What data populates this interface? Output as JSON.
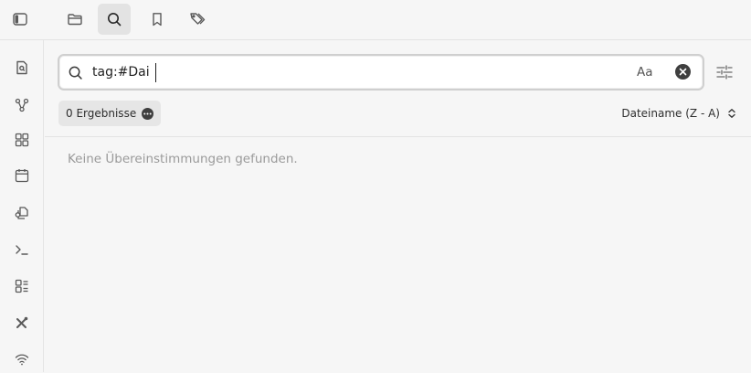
{
  "topbar": {
    "tabs": [
      {
        "icon": "folder-icon",
        "label": "Dateien"
      },
      {
        "icon": "search-icon",
        "label": "Suche"
      },
      {
        "icon": "bookmark-icon",
        "label": "Lesezeichen"
      },
      {
        "icon": "tags-icon",
        "label": "Tags"
      }
    ],
    "active_tab": "search",
    "sidebar_toggle_icon": "sidebar-toggle-icon"
  },
  "ribbon": {
    "items": [
      {
        "icon": "file-search-icon"
      },
      {
        "icon": "graph-icon"
      },
      {
        "icon": "canvas-grid-icon"
      },
      {
        "icon": "calendar-icon"
      },
      {
        "icon": "copy-files-icon"
      },
      {
        "icon": "terminal-icon"
      },
      {
        "icon": "templates-icon"
      },
      {
        "icon": "tools-icon"
      },
      {
        "icon": "wifi-icon"
      }
    ]
  },
  "search": {
    "value": "tag:#Dai",
    "match_case_label": "Aa",
    "clear_icon": "clear-icon",
    "filter_icon": "sliders-icon"
  },
  "results": {
    "count_label": "0 Ergebnisse",
    "more_icon": "more-options-icon",
    "sort_label": "Dateiname (Z - A)",
    "sort_icon": "chevron-up-down-icon",
    "empty_message": "Keine Übereinstimmungen gefunden."
  },
  "colors": {
    "background": "#f6f6f6",
    "input_background": "#ffffff",
    "border": "#cfcfcf",
    "muted_text": "#9a9a9a"
  }
}
